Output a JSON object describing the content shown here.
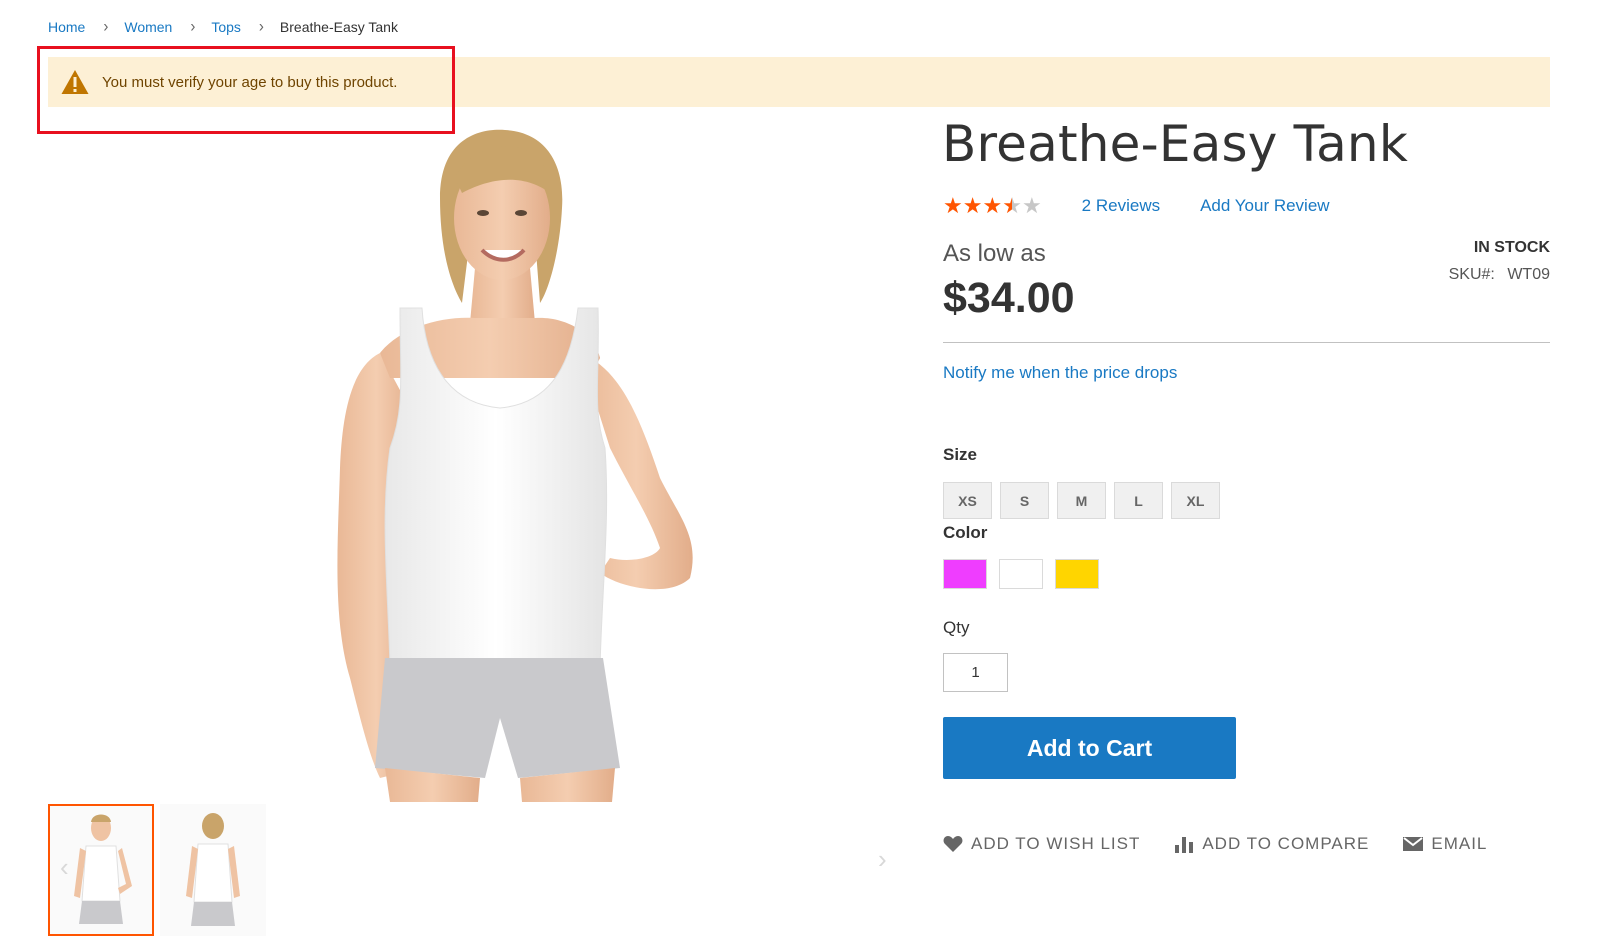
{
  "breadcrumb": {
    "items": [
      "Home",
      "Women",
      "Tops"
    ],
    "current": "Breathe-Easy Tank"
  },
  "notice": {
    "message": "You must verify your age to buy this product."
  },
  "product": {
    "title": "Breathe-Easy Tank",
    "rating_out_of_5": 3.5,
    "reviews_link": "2  Reviews",
    "add_review_link": "Add Your Review",
    "price_prefix": "As low as",
    "price": "$34.00",
    "stock": "IN STOCK",
    "sku_label": "SKU#:",
    "sku": "WT09",
    "notify_link": "Notify me when the price drops"
  },
  "options": {
    "size_label": "Size",
    "sizes": [
      "XS",
      "S",
      "M",
      "L",
      "XL"
    ],
    "color_label": "Color",
    "colors": [
      "#ef3dff",
      "#ffffff",
      "#ffd500"
    ],
    "qty_label": "Qty",
    "qty_value": "1"
  },
  "cart": {
    "add_to_cart_label": "Add to Cart"
  },
  "actions": {
    "wishlist": "ADD TO WISH LIST",
    "compare": "ADD TO COMPARE",
    "email": "EMAIL"
  },
  "colors": {
    "link": "#1979c3",
    "accent": "#ff5501",
    "notice_bg": "#fdf0d5",
    "highlight": "#e8101f"
  }
}
